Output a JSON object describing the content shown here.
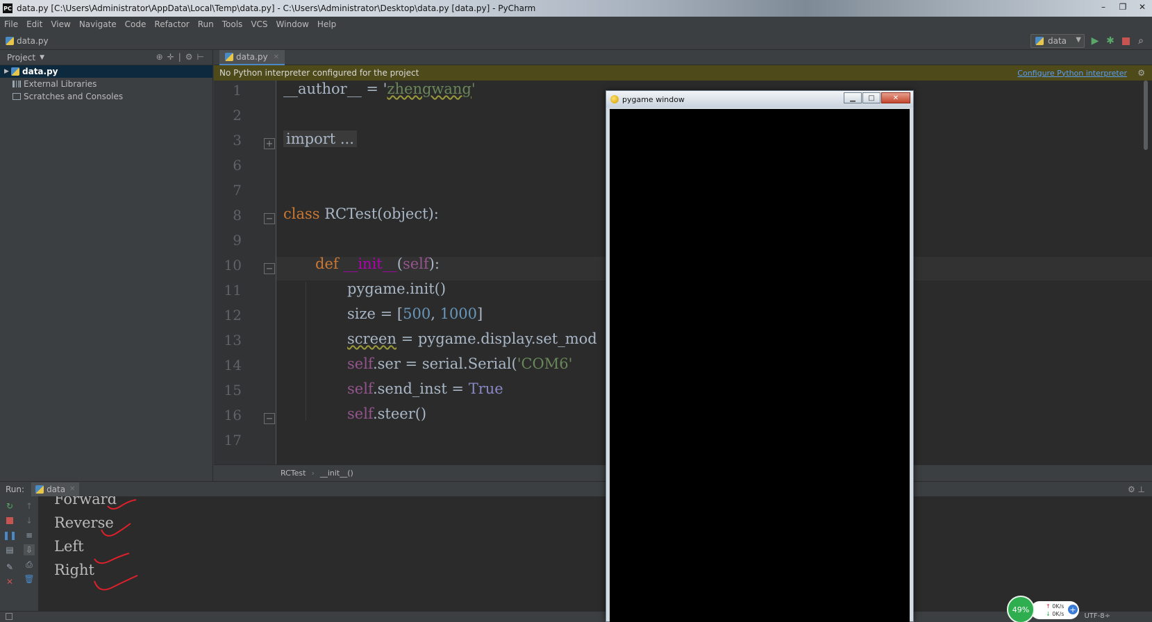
{
  "window": {
    "title": "data.py [C:\\Users\\Administrator\\AppData\\Local\\Temp\\data.py] - C:\\Users\\Administrator\\Desktop\\data.py [data.py] - PyCharm",
    "app_icon_text": "PC",
    "minimize": "–",
    "maximize": "❐",
    "close": "✕"
  },
  "menu": [
    "File",
    "Edit",
    "View",
    "Navigate",
    "Code",
    "Refactor",
    "Run",
    "Tools",
    "VCS",
    "Window",
    "Help"
  ],
  "navbar": {
    "file": "data.py",
    "run_config": "data"
  },
  "project": {
    "header": "Project",
    "items": [
      "data.py",
      "External Libraries",
      "Scratches and Consoles"
    ]
  },
  "editor": {
    "tab": "data.py",
    "banner_text": "No Python interpreter configured for the project",
    "banner_link": "Configure Python interpreter",
    "line_numbers": [
      "1",
      "2",
      "3",
      "6",
      "7",
      "8",
      "9",
      "10",
      "11",
      "12",
      "13",
      "14",
      "15",
      "16",
      "17"
    ],
    "lines": {
      "l1_a": "__author__ = '",
      "l1_b": "zhengwang",
      "l1_c": "'",
      "l3": "import ...",
      "l8_kw": "class",
      "l8_rest": " RCTest(object):",
      "l10_kw": "def",
      "l10_name": "__init__",
      "l10_p1": "(",
      "l10_self": "self",
      "l10_p2": "):",
      "l11": "pygame.init()",
      "l12_a": "size = [",
      "l12_n1": "500",
      "l12_b": ", ",
      "l12_n2": "1000",
      "l12_c": "]",
      "l13_a": "screen",
      "l13_b": " = pygame.display.set_mod",
      "l14_self": "self",
      "l14_b": ".ser = serial.Serial(",
      "l14_str": "'COM6'",
      "l15_self": "self",
      "l15_b": ".send_inst = ",
      "l15_true": "True",
      "l16_self": "self",
      "l16_b": ".steer()"
    },
    "breadcrumbs": [
      "RCTest",
      "__init__()"
    ]
  },
  "run": {
    "label": "Run:",
    "tab": "data",
    "output": [
      "Forward",
      "Reverse",
      "Left",
      "Right"
    ]
  },
  "pygame": {
    "title": "pygame window"
  },
  "status": {
    "encoding": "UTF-8÷"
  },
  "net_widget": {
    "percent": "49%",
    "up": "0K/s",
    "down": "0K/s"
  }
}
